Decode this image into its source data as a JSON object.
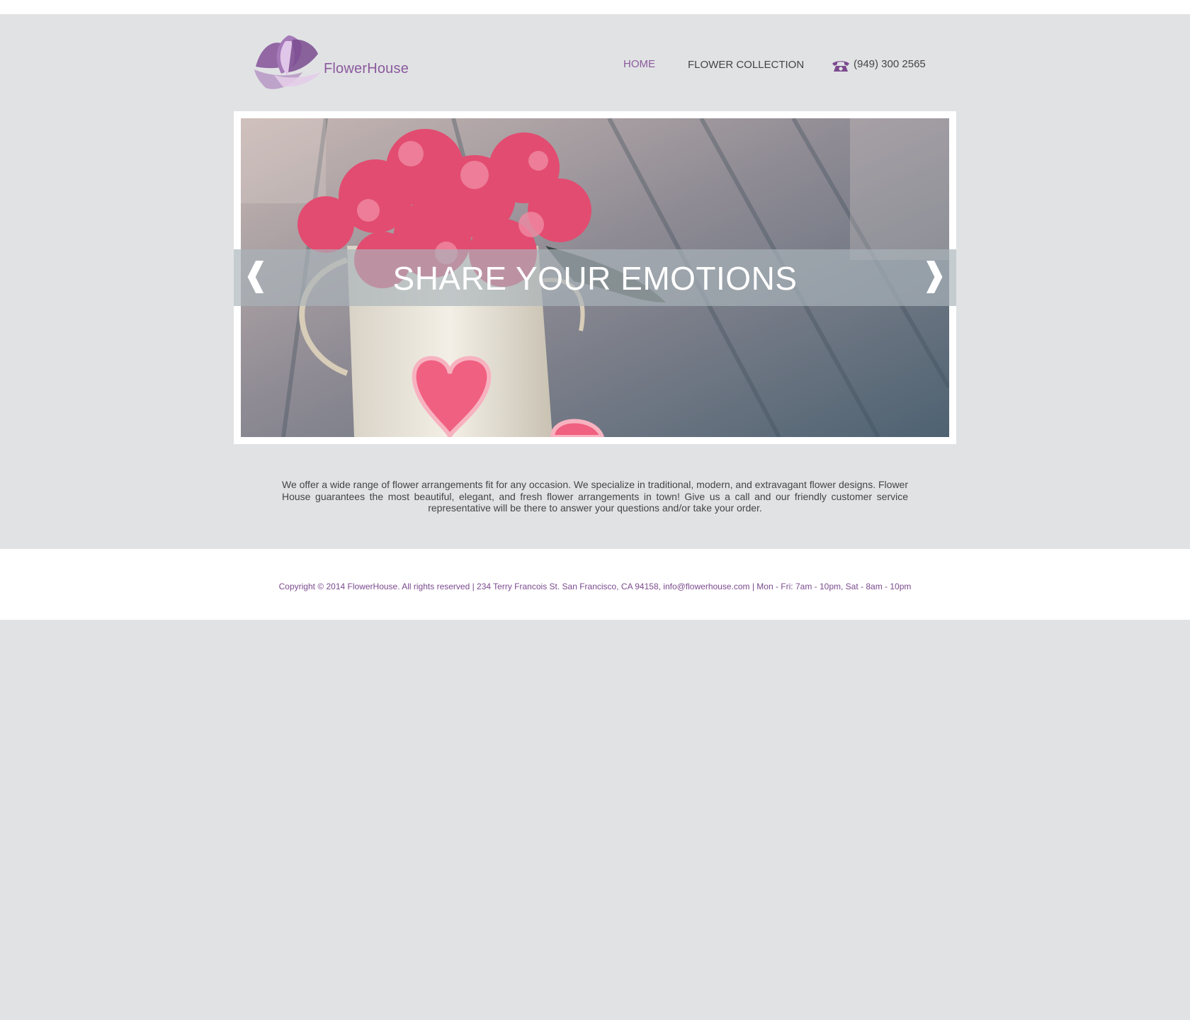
{
  "brand": {
    "name": "FlowerHouse",
    "logo_icon": "lotus-logo-icon",
    "accent_color": "#8a5a9c"
  },
  "nav": {
    "items": [
      {
        "label": "HOME",
        "active": true
      },
      {
        "label": "FLOWER COLLECTION",
        "active": false
      }
    ],
    "phone": {
      "icon": "telephone-icon",
      "number": "(949) 300 2565"
    }
  },
  "slider": {
    "caption": "SHARE YOUR EMOTIONS",
    "prev_glyph": "❰",
    "next_glyph": "❱",
    "image": "pink-flowers-in-white-watering-can-with-hearts"
  },
  "intro": {
    "text": "We offer a wide range of flower arrangements fit for any occasion. We specialize in traditional, modern, and extravagant flower designs. Flower House guarantees the most beautiful, elegant, and fresh flower arrangements in town! Give us a call and our friendly customer service representative will be there to answer your questions and/or take your order."
  },
  "footer": {
    "text": "Copyright © 2014 FlowerHouse. All rights reserved  |  234 Terry Francois St. San Francisco, CA 94158, info@flowerhouse.com  |  Mon - Fri: 7am - 10pm, Sat - 8am - 10pm"
  }
}
